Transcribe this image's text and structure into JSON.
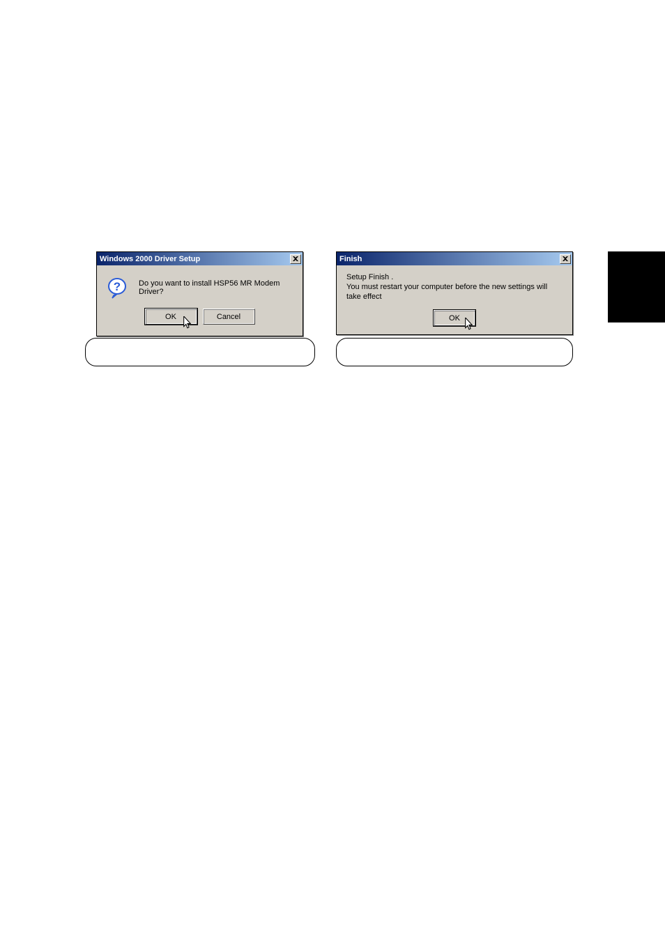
{
  "dialog1": {
    "title": "Windows 2000 Driver Setup",
    "message": "Do you want to install HSP56 MR Modem Driver?",
    "ok_label": "OK",
    "cancel_label": "Cancel"
  },
  "dialog2": {
    "title": "Finish",
    "line1": "Setup Finish .",
    "line2": "You must restart your computer before the new settings will take effect",
    "ok_label": "OK"
  },
  "icons": {
    "question": "question-icon",
    "close": "close-icon",
    "cursor": "mouse-cursor"
  }
}
